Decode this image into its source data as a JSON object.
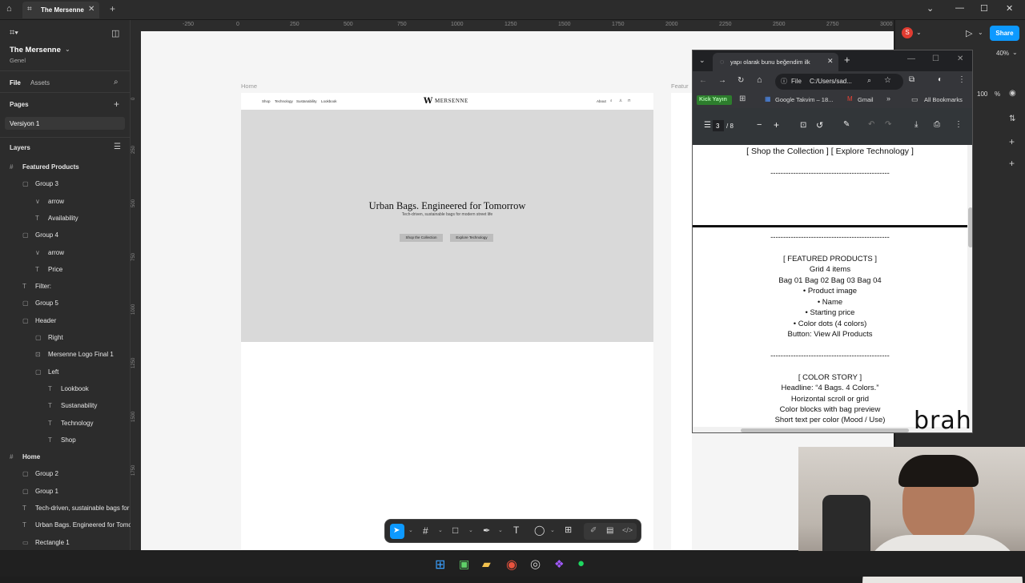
{
  "titlebar": {
    "tab_title": "The Mersenne"
  },
  "left_panel": {
    "file_name": "The Mersenne",
    "team": "Genel",
    "tabs": [
      "File",
      "Assets"
    ],
    "pages_label": "Pages",
    "page_item": "Versiyon 1",
    "layers_label": "Layers",
    "layers": [
      {
        "label": "Featured Products",
        "indent": 0,
        "icon": "#"
      },
      {
        "label": "Group 3",
        "indent": 1,
        "icon": "▢"
      },
      {
        "label": "arrow",
        "indent": 2,
        "icon": "∨"
      },
      {
        "label": "Availability",
        "indent": 2,
        "icon": "T"
      },
      {
        "label": "Group 4",
        "indent": 1,
        "icon": "▢"
      },
      {
        "label": "arrow",
        "indent": 2,
        "icon": "∨"
      },
      {
        "label": "Price",
        "indent": 2,
        "icon": "T"
      },
      {
        "label": "Filter:",
        "indent": 1,
        "icon": "T"
      },
      {
        "label": "Group 5",
        "indent": 1,
        "icon": "▢"
      },
      {
        "label": "Header",
        "indent": 1,
        "icon": "▢"
      },
      {
        "label": "Right",
        "indent": 2,
        "icon": "▢"
      },
      {
        "label": "Mersenne Logo Final 1",
        "indent": 2,
        "icon": "⊡"
      },
      {
        "label": "Left",
        "indent": 2,
        "icon": "▢"
      },
      {
        "label": "Lookbook",
        "indent": 3,
        "icon": "T"
      },
      {
        "label": "Sustanability",
        "indent": 3,
        "icon": "T"
      },
      {
        "label": "Technology",
        "indent": 3,
        "icon": "T"
      },
      {
        "label": "Shop",
        "indent": 3,
        "icon": "T"
      },
      {
        "label": "Home",
        "indent": 0,
        "icon": "#"
      },
      {
        "label": "Group 2",
        "indent": 1,
        "icon": "▢"
      },
      {
        "label": "Group 1",
        "indent": 1,
        "icon": "▢"
      },
      {
        "label": "Tech-driven, sustainable bags for",
        "indent": 1,
        "icon": "T"
      },
      {
        "label": "Urban Bags. Engineered for Tomo",
        "indent": 1,
        "icon": "T"
      },
      {
        "label": "Rectangle 1",
        "indent": 1,
        "icon": "▭"
      }
    ]
  },
  "ruler": {
    "top": [
      "-250",
      "0",
      "250",
      "500",
      "750",
      "1000",
      "1250",
      "1500",
      "1750",
      "2000",
      "2250",
      "2500",
      "2750",
      "3000"
    ],
    "left": [
      "0",
      "250",
      "500",
      "750",
      "1000",
      "1250",
      "1500",
      "1750"
    ]
  },
  "canvas": {
    "frame_label": "Home",
    "frame_label_2": "Featur",
    "nav_left": [
      "Shop",
      "Technology",
      "Sustanability",
      "Lookbook"
    ],
    "logo": "MERSENNE",
    "nav_right": "About",
    "hero_title": "Urban Bags. Engineered for Tomorrow",
    "hero_sub": "Tech-driven, sustainable bags for modern street life",
    "btn1": "Shop the Collection",
    "btn2": "Explore Technology"
  },
  "right_panel": {
    "avatar": "S",
    "share": "Share",
    "zoom": "40%",
    "zoom2": "100",
    "pct": "%"
  },
  "pdf": {
    "tab_title": "yapı olarak bunu beğendim ilk",
    "addr_file": "File",
    "addr_path": "C:/Users/sad...",
    "bookmarks": [
      "Kick Yayın",
      "Google Takvim – 18...",
      "Gmail",
      "All Bookmarks"
    ],
    "page_current": "3",
    "page_total": "/  8",
    "lines_top": [
      "[ Shop the Collection ]   [ Explore Technology ]",
      "-----------------------------------------------"
    ],
    "lines": [
      "-----------------------------------------------",
      "[ FEATURED PRODUCTS ]",
      "Grid 4 items",
      "Bag 01   Bag 02   Bag 03   Bag 04",
      "•  Product image",
      "•  Name",
      "•  Starting price",
      "•  Color dots (4 colors)",
      "Button: View All Products",
      "-----------------------------------------------",
      "[ COLOR STORY ]",
      "Headline: “4 Bags. 4 Colors.”",
      "Horizontal scroll or grid",
      "Color blocks with bag preview",
      "Short text per color (Mood / Use)"
    ]
  },
  "watermark": "brah"
}
